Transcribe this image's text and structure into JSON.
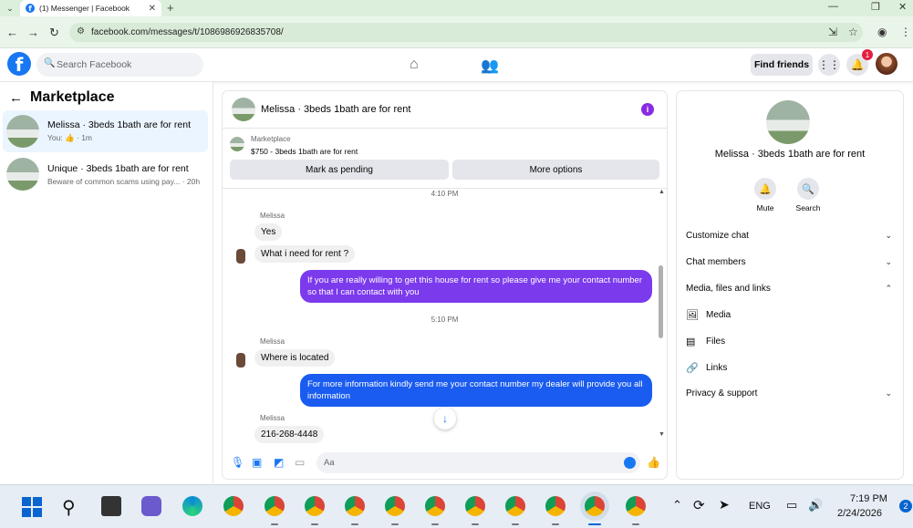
{
  "browser": {
    "tab_title": "(1) Messenger | Facebook",
    "tab_close": "✕",
    "new_tab": "+",
    "url": "facebook.com/messages/t/1086986926835708/"
  },
  "fb_header": {
    "search_placeholder": "Search Facebook",
    "find_friends": "Find friends",
    "notification_count": "1"
  },
  "sidebar": {
    "heading": "Marketplace",
    "conversations": [
      {
        "title": "Melissa · 3beds 1bath are for rent",
        "preview": "You: 👍 · 1m",
        "active": true
      },
      {
        "title": "Unique · 3beds 1bath are for rent",
        "preview": "Beware of common scams using pay... · 20h",
        "active": false
      }
    ]
  },
  "chat": {
    "title": "Melissa · 3beds 1bath are for rent",
    "listing_label": "Marketplace",
    "listing_price": "$750 - 3beds 1bath are for rent",
    "mark_pending": "Mark as pending",
    "more_options": "More options",
    "time1": "4:10 PM",
    "sender1": "Melissa",
    "msg_yes": "Yes",
    "msg_need": "What i need for rent ?",
    "msg_out1": "If you are really willing to get this house for rent so please give me your contact number so that I can contact with you",
    "time2": "5:10 PM",
    "sender2": "Melissa",
    "msg_where": "Where is located",
    "msg_out2": "For more information kindly send me your contact number my dealer will provide you all information",
    "sender3": "Melissa",
    "msg_phone": "216-268-4448",
    "composer_placeholder": "Aa"
  },
  "details": {
    "name": "Melissa · 3beds 1bath are for rent",
    "mute": "Mute",
    "search": "Search",
    "customize_chat": "Customize chat",
    "chat_members": "Chat members",
    "media_files_links": "Media, files and links",
    "media": "Media",
    "files": "Files",
    "links": "Links",
    "privacy_support": "Privacy & support"
  },
  "taskbar": {
    "language": "ENG",
    "time": "7:19 PM",
    "date": "2/24/2026",
    "badge": "2"
  },
  "colors": {
    "fb_blue": "#1877f2",
    "outgoing_purple": "#7c3aed",
    "outgoing_blue": "#1a5cf0",
    "notif_red": "#e41e3f"
  }
}
